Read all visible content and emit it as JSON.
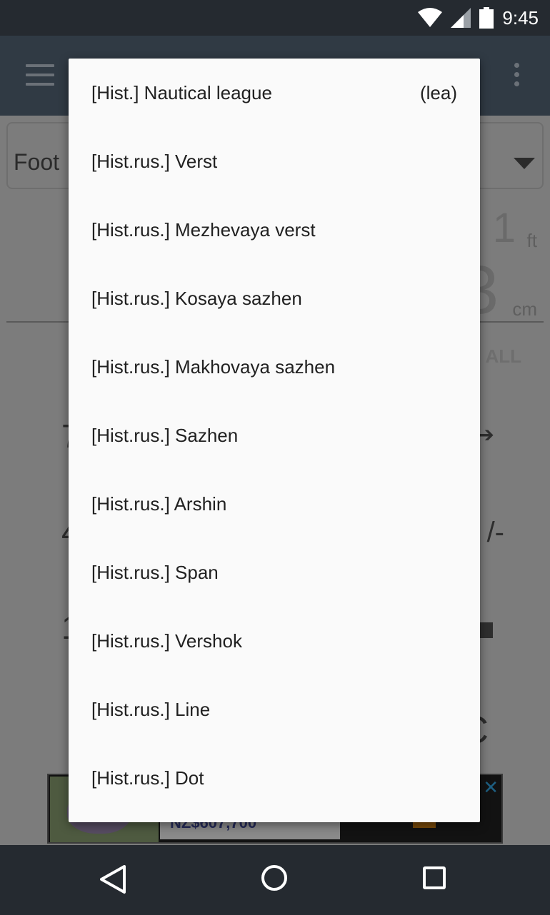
{
  "status_bar": {
    "time": "9:45",
    "icons": [
      "wifi-icon",
      "cell-signal-icon",
      "battery-icon"
    ]
  },
  "app_bar": {
    "icons": [
      "hamburger-menu-icon",
      "overflow-menu-icon"
    ]
  },
  "background": {
    "unit_selector_value": "Foot",
    "value_ft": "1",
    "unit_ft": "ft",
    "value_cm": "3",
    "unit_cm": "cm",
    "clear_all_label": "ALL",
    "operator_minus": "/-",
    "key_c": "C",
    "left_digit_1": "7",
    "left_digit_2": "4",
    "left_digit_3": "1"
  },
  "ad": {
    "price": "NZ$607,700",
    "close_label": "✕"
  },
  "dropdown": {
    "items": [
      {
        "label": "[Hist.] Nautical league",
        "symbol": "(lea)"
      },
      {
        "label": "[Hist.rus.] Verst",
        "symbol": ""
      },
      {
        "label": "[Hist.rus.] Mezhevaya verst",
        "symbol": ""
      },
      {
        "label": "[Hist.rus.] Kosaya sazhen",
        "symbol": ""
      },
      {
        "label": "[Hist.rus.] Makhovaya sazhen",
        "symbol": ""
      },
      {
        "label": "[Hist.rus.] Sazhen",
        "symbol": ""
      },
      {
        "label": "[Hist.rus.] Arshin",
        "symbol": ""
      },
      {
        "label": "[Hist.rus.] Span",
        "symbol": ""
      },
      {
        "label": "[Hist.rus.] Vershok",
        "symbol": ""
      },
      {
        "label": "[Hist.rus.] Line",
        "symbol": ""
      },
      {
        "label": "[Hist.rus.] Dot",
        "symbol": ""
      }
    ]
  },
  "nav_bar": {
    "icons": [
      "back-icon",
      "home-icon",
      "recents-icon"
    ]
  },
  "colors": {
    "popup_bg": "#fafafa",
    "system_bar": "#252a30",
    "scrim_content": "#7c7c7c"
  }
}
